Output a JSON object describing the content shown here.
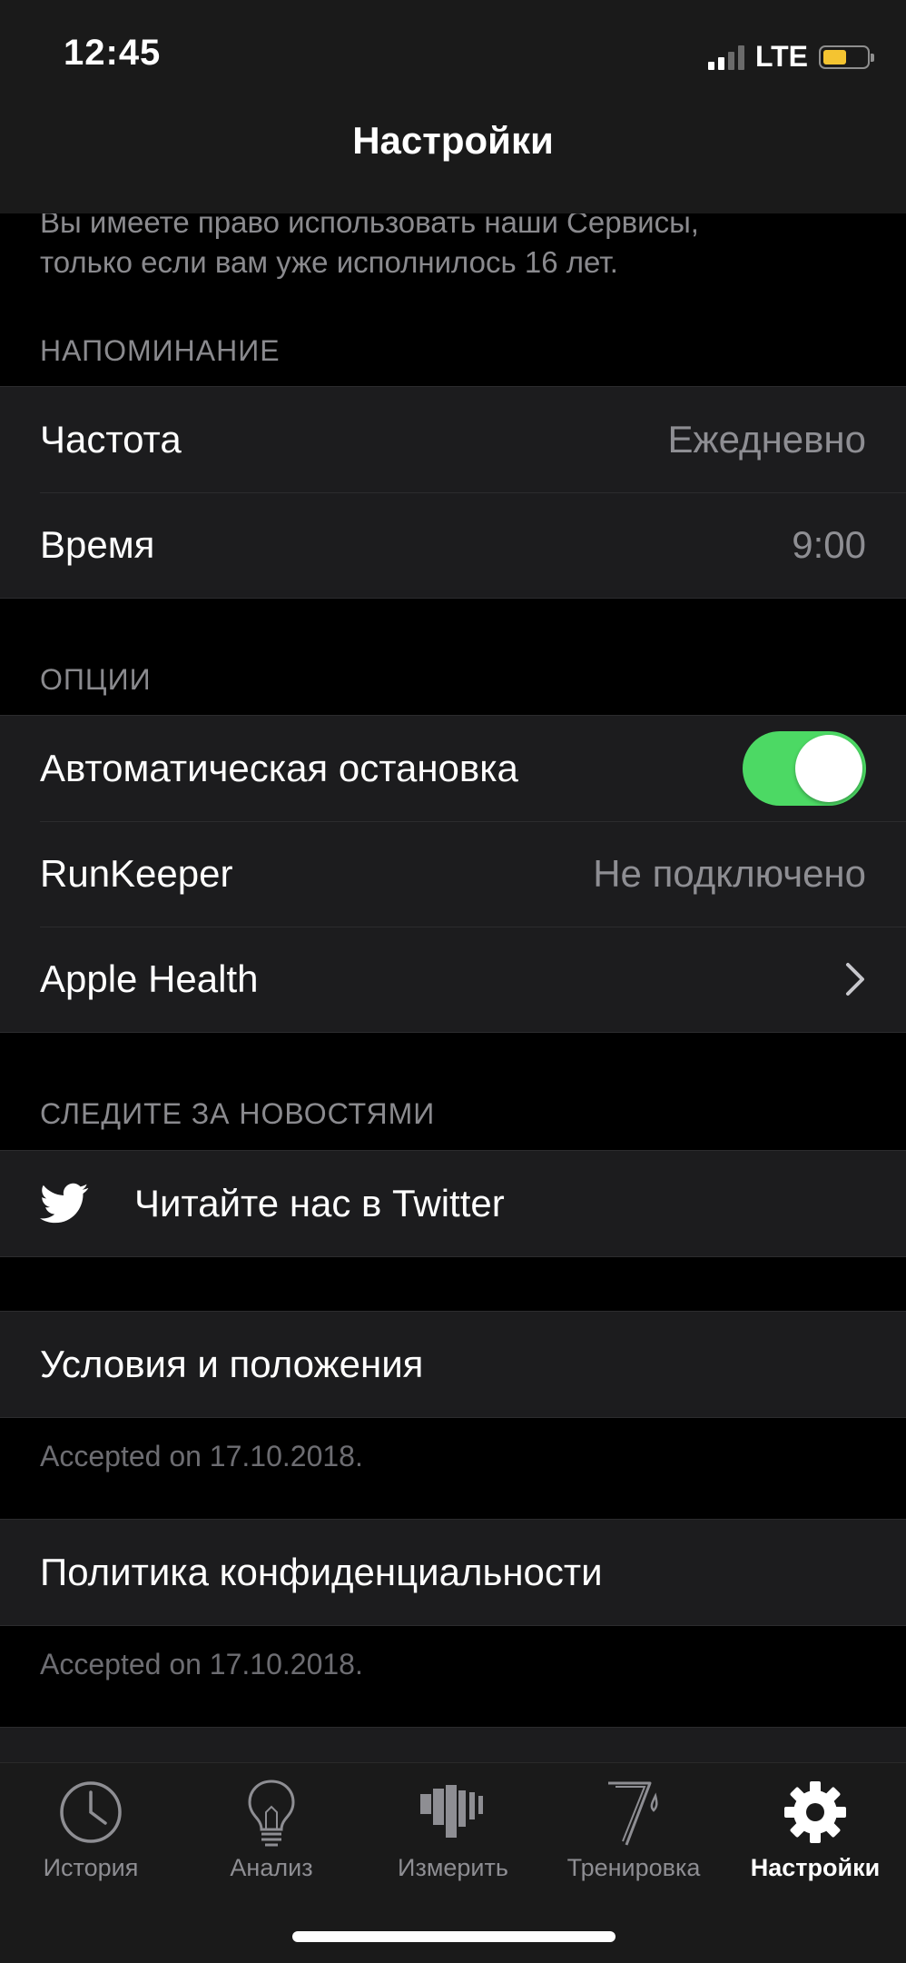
{
  "status_bar": {
    "time": "12:45",
    "network": "LTE",
    "battery_color": "#f4c431"
  },
  "nav": {
    "title": "Настройки"
  },
  "age_notice": {
    "line1": "Вы имеете право использовать наши Сервисы,",
    "line2": "только если вам уже исполнилось 16 лет."
  },
  "reminder": {
    "header": "НАПОМИНАНИЕ",
    "frequency_label": "Частота",
    "frequency_value": "Ежедневно",
    "time_label": "Время",
    "time_value": "9:00"
  },
  "options": {
    "header": "ОПЦИИ",
    "autopause_label": "Автоматическая остановка",
    "autopause_on": true,
    "runkeeper_label": "RunKeeper",
    "runkeeper_value": "Не подключено",
    "apple_health_label": "Apple Health"
  },
  "news": {
    "header": "СЛЕДИТЕ ЗА НОВОСТЯМИ",
    "twitter_label": "Читайте нас в Twitter"
  },
  "terms": {
    "label": "Условия и положения",
    "accepted": "Accepted on 17.10.2018."
  },
  "privacy": {
    "label": "Политика конфиденциальности",
    "accepted": "Accepted on 17.10.2018."
  },
  "tabs": [
    {
      "label": "История",
      "icon": "clock-icon"
    },
    {
      "label": "Анализ",
      "icon": "lightbulb-icon"
    },
    {
      "label": "Измерить",
      "icon": "measure-icon"
    },
    {
      "label": "Тренировка",
      "icon": "training-icon"
    },
    {
      "label": "Настройки",
      "icon": "gear-icon",
      "active": true
    }
  ],
  "colors": {
    "accent_toggle": "#4cd964",
    "background": "#000000",
    "cell": "#1c1c1e"
  }
}
